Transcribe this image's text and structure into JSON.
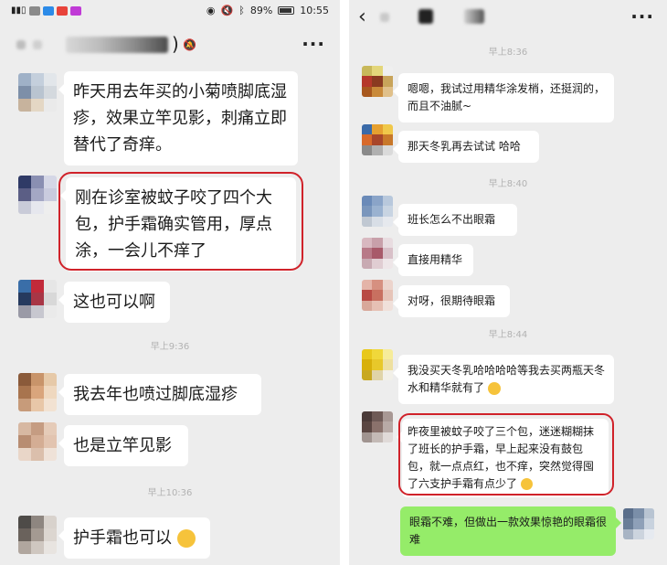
{
  "left": {
    "status": {
      "battery": "89%",
      "time": "10:55"
    },
    "header": {
      "title_suffix": ")"
    },
    "messages": [
      {
        "text": "昨天用去年买的小菊喷脚底湿疹，效果立竿见影，刺痛立即替代了奇痒。"
      },
      {
        "text": "刚在诊室被蚊子咬了四个大包，护手霜确实管用，厚点涂，一会儿不痒了"
      },
      {
        "text": "这也可以啊"
      },
      {
        "text": "我去年也喷过脚底湿疹"
      },
      {
        "text": "也是立竿见影"
      },
      {
        "text": "护手霜也可以"
      }
    ],
    "timestamps": [
      "早上9:36",
      "早上10:36"
    ]
  },
  "right": {
    "timestamps": [
      "早上8:36",
      "早上8:40",
      "早上8:44"
    ],
    "messages": [
      {
        "text": "嗯嗯，我试过用精华涂发梢，还挺润的，而且不油腻~"
      },
      {
        "text": "那天冬乳再去试试 哈哈"
      },
      {
        "text": "班长怎么不出眼霜"
      },
      {
        "text": "直接用精华"
      },
      {
        "text": "对呀，很期待眼霜"
      },
      {
        "text": "我没买天冬乳哈哈哈哈等我去买两瓶天冬水和精华就有了"
      },
      {
        "text": "昨夜里被蚊子咬了三个包，迷迷糊糊抹了班长的护手霜，早上起来没有鼓包包，就一点点红，也不痒，突然觉得囤了六支护手霜有点少了"
      },
      {
        "text": "眼霜不难，但做出一款效果惊艳的眼霜很难"
      }
    ]
  },
  "colors": {
    "highlight": "#d0222a",
    "bubble_mine": "#95ec69",
    "chat_bg": "#ededed"
  }
}
